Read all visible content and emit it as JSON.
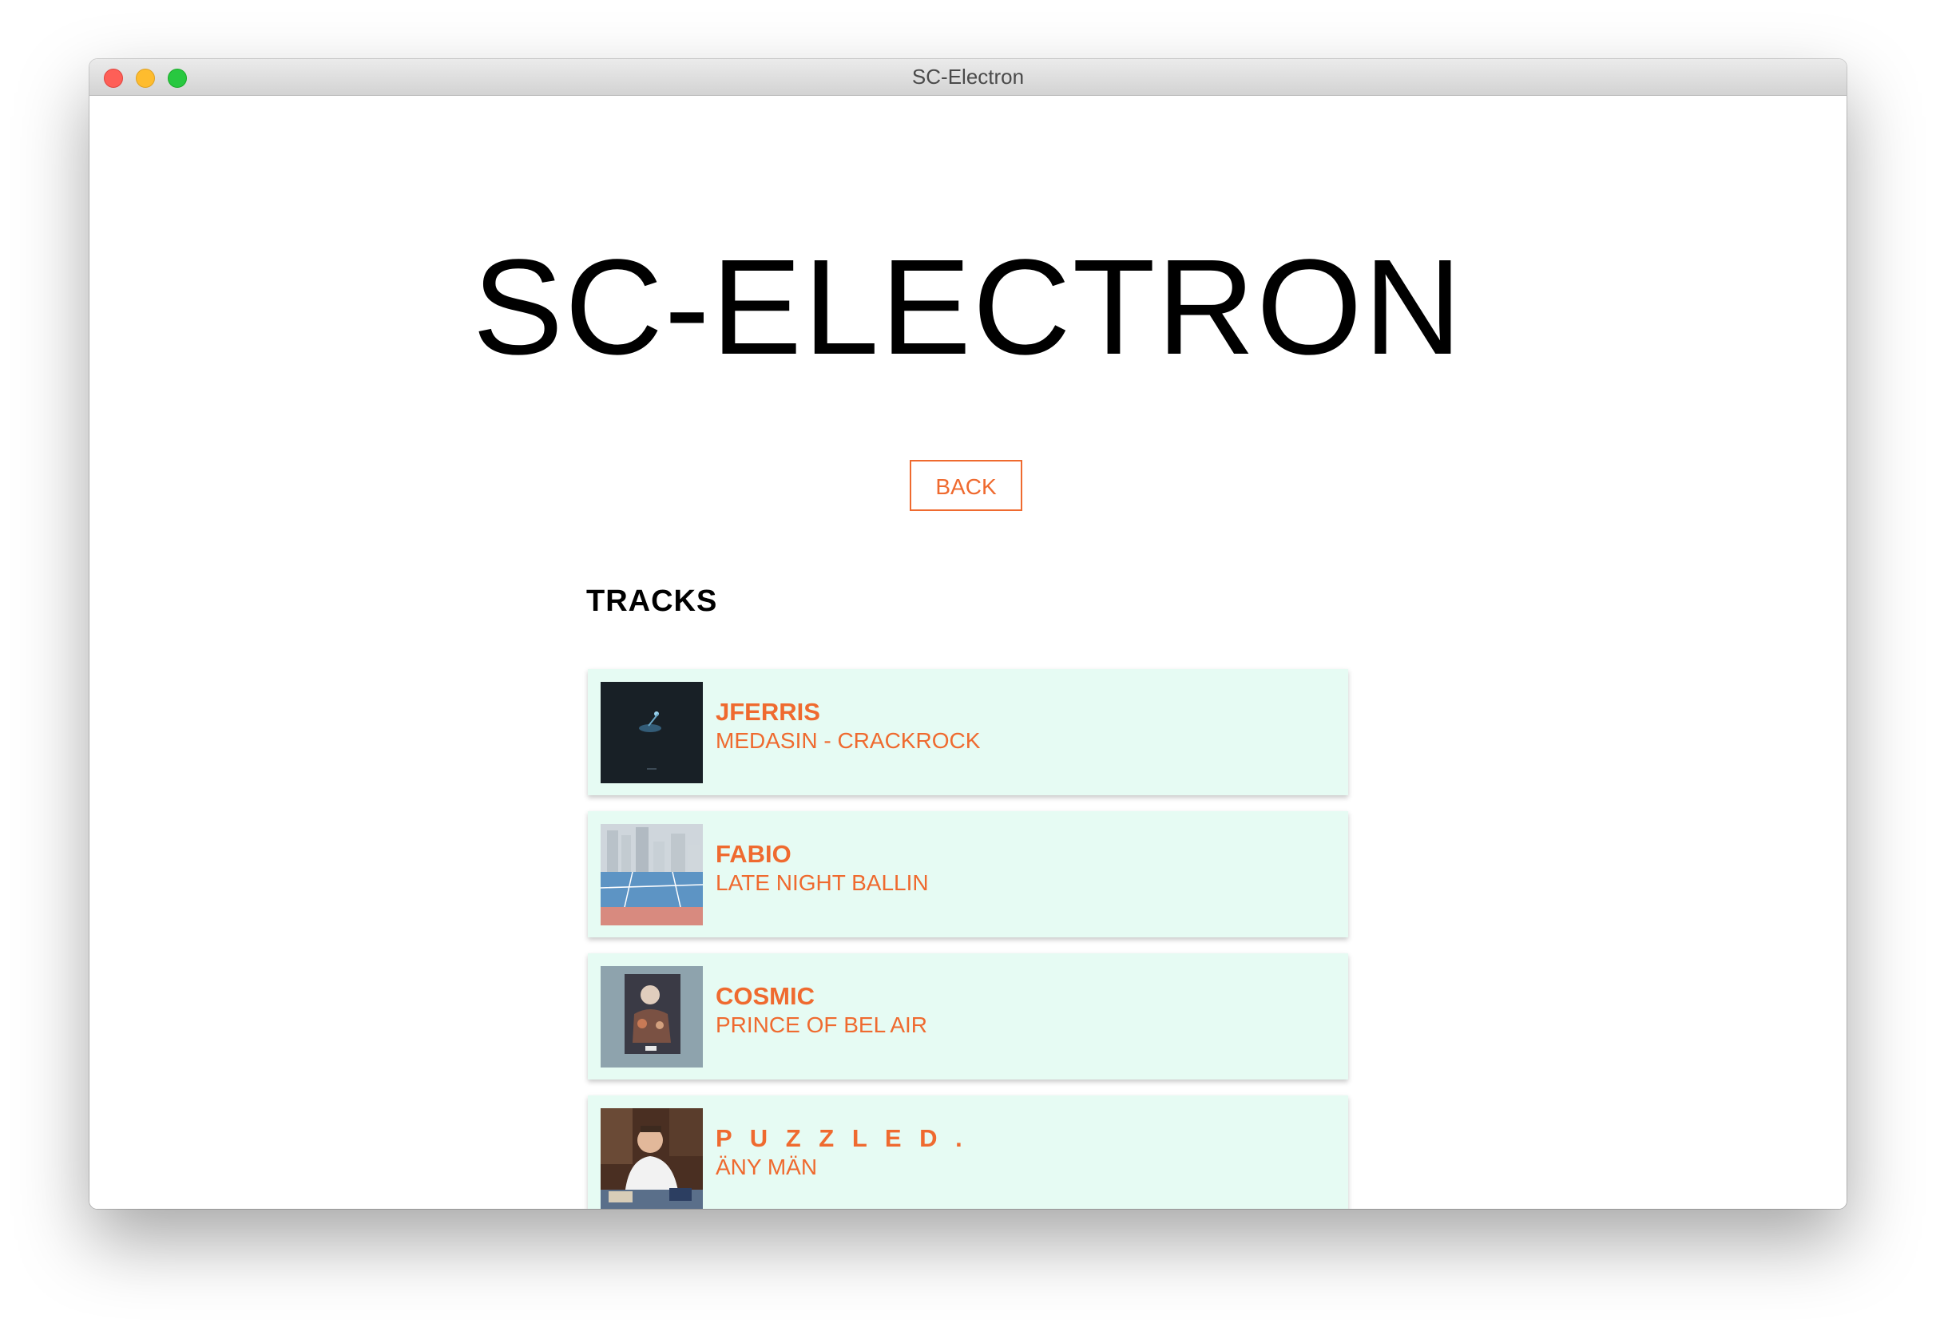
{
  "window": {
    "title": "SC-Electron"
  },
  "header": {
    "app_title": "SC-ELECTRON"
  },
  "nav": {
    "back_label": "BACK"
  },
  "tracks_section": {
    "heading": "TRACKS",
    "items": [
      {
        "artist": "JFERRIS",
        "title": "MEDASIN - CRACKROCK",
        "artwork_icon": "dark-blue-artwork"
      },
      {
        "artist": "FABIO",
        "title": "LATE NIGHT BALLIN",
        "artwork_icon": "basketball-court-artwork"
      },
      {
        "artist": "COSMIC",
        "title": "PRINCE OF BEL AIR",
        "artwork_icon": "portrait-poster-artwork"
      },
      {
        "artist": "P U Z Z L E D .",
        "title": "ÄNY MÄN",
        "artwork_icon": "person-photo-artwork"
      }
    ]
  },
  "colors": {
    "accent": "#ef6a2f",
    "card_background": "#e6fbf3",
    "title_text": "#000000"
  }
}
